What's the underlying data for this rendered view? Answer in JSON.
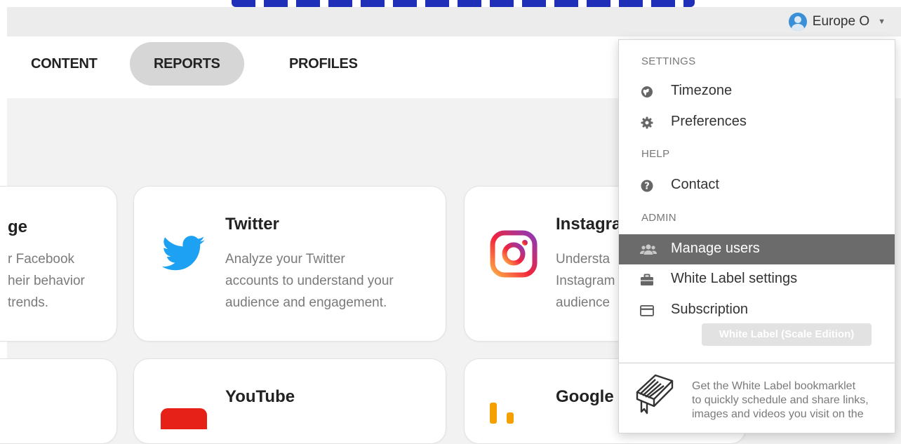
{
  "user": {
    "name": "Europe O"
  },
  "nav": {
    "tabs": [
      {
        "label": "CONTENT"
      },
      {
        "label": "REPORTS"
      },
      {
        "label": "PROFILES"
      }
    ]
  },
  "cards": {
    "facebook": {
      "title": "ge",
      "desc": [
        "r Facebook",
        "heir behavior",
        "trends."
      ]
    },
    "twitter": {
      "title": "Twitter",
      "desc": [
        "Analyze your Twitter",
        "accounts to understand your",
        "audience and engagement."
      ]
    },
    "instagram": {
      "title": "Instagra",
      "desc": [
        "Understa",
        "Instagram",
        "audience"
      ]
    },
    "youtube": {
      "title": "YouTube"
    },
    "google": {
      "title": "Google"
    }
  },
  "dropdown": {
    "settings_header": "SETTINGS",
    "timezone": "Timezone",
    "preferences": "Preferences",
    "help_header": "HELP",
    "contact": "Contact",
    "admin_header": "ADMIN",
    "manage_users": "Manage users",
    "white_label_settings": "White Label settings",
    "subscription": "Subscription",
    "edition_badge": "White Label (Scale Edition)",
    "bookmarklet_text": [
      "Get the White Label bookmarklet",
      "to quickly schedule and share links,",
      "images and videos you visit on the"
    ]
  },
  "colors": {
    "twitter_blue": "#1da1f2",
    "active_item_bg": "#6b6b6b",
    "youtube_red": "#e62117",
    "google_orange": "#f4a000"
  }
}
